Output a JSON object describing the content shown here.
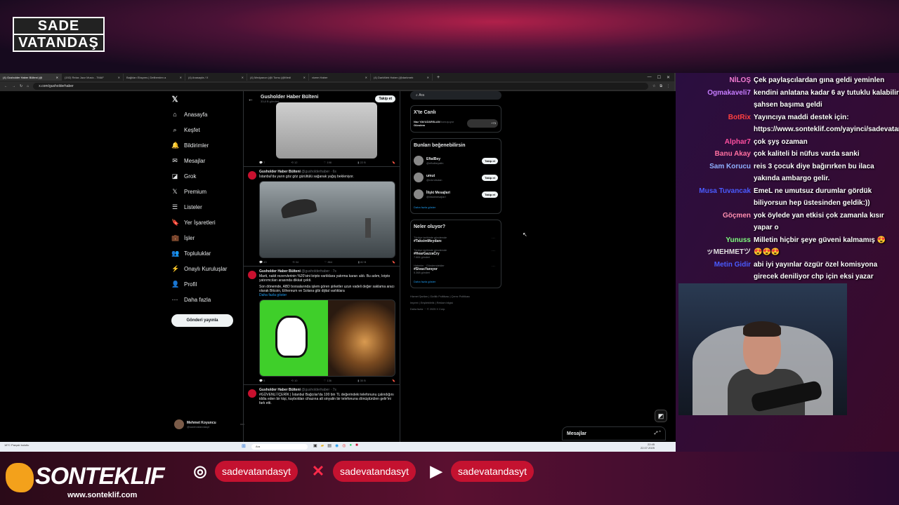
{
  "overlay": {
    "brand_line1": "SADE",
    "brand_line2": "VATANDAŞ"
  },
  "browser": {
    "tabs": [
      "(4) Gusholder Haber Bülteni (@",
      "(192) Relax Jazz Music - 7MAF",
      "Bağlıları Ekspres | Deliberden a",
      "(4) Anasayfa / X",
      "(4) Medyanon (@i Tomu (@Medi",
      "vizem Haber",
      "(4) DarkMeb Haber (@darkmeb"
    ],
    "url": "x.com/gusholderhaber"
  },
  "nav": {
    "items": [
      {
        "label": "Anasayfa",
        "icon": "⌂"
      },
      {
        "label": "Keşfet",
        "icon": "⌕"
      },
      {
        "label": "Bildirimler",
        "icon": "🔔"
      },
      {
        "label": "Mesajlar",
        "icon": "✉"
      },
      {
        "label": "Grok",
        "icon": "◪"
      },
      {
        "label": "Premium",
        "icon": "𝕏"
      },
      {
        "label": "Listeler",
        "icon": "☰"
      },
      {
        "label": "Yer İşaretleri",
        "icon": "🔖"
      },
      {
        "label": "İşler",
        "icon": "💼"
      },
      {
        "label": "Topluluklar",
        "icon": "👥"
      },
      {
        "label": "Onaylı Kuruluşlar",
        "icon": "⚡"
      },
      {
        "label": "Profil",
        "icon": "👤"
      },
      {
        "label": "Daha fazla",
        "icon": "⋯"
      }
    ],
    "post_button": "Gönderi yayınla",
    "profile_name": "Mehmet Koyuncu",
    "profile_handle": "@sadevatandasyt"
  },
  "feed": {
    "header_name": "Gusholder Haber Bülteni",
    "header_sub": "33,8 B gönderi",
    "follow_label": "Takip et",
    "posts": [
      {
        "author": "Gusholder Haber Bülteni",
        "handle": "@gusholderhaber · 6s",
        "text": "İstanbul'da yarın göz göz gürültülü sağanak yağış bekleniyor.",
        "more": "",
        "actions": [
          "43",
          "34",
          "864",
          "82 B"
        ]
      },
      {
        "author": "Gusholder Haber Bülteni",
        "handle": "@gusholderhaber · 7s",
        "text": "Marti, nakit rezervlerinin %20'sini kripto varlıklara yatırma kararı aldı. Bu adım, kripto yatırımcıları arasında dikkat çekti.",
        "text2": "Son dönemde, ABD borsalarında işlem gören şirketler uzun vadeli değer saklama aracı olarak Bitcoin, Ethereum ve Solana gibi dijital varlıklara",
        "more": "Daha fazla göster",
        "actions": [
          "5",
          "10",
          "136",
          "30 B"
        ]
      },
      {
        "author": "Gusholder Haber Bülteni",
        "handle": "@gusholderhaber · 7s",
        "text": "#GÜVENLİ İÇERİK | İstanbul Bağcılar'da 100 bin TL değerindeki telefonunu çalındığını iddia eden bir kişi, kayboldan cihazına alt sinyalin bir telefonuna dönüştürülen gelir'ini fark etti.",
        "more": "",
        "actions": []
      }
    ],
    "top_actions": [
      "7",
      "12",
      "198",
      "22 B"
    ]
  },
  "right": {
    "search_value": "Ara",
    "live_title": "X'te Canlı",
    "live_host": "Naz YAVUZARSLAN",
    "live_host_suffix": "konuşuyor",
    "live_topic": "Gündem",
    "live_count": "+73",
    "suggest_title": "Bunları beğenebilirsin",
    "suggestions": [
      {
        "name": "EftalBey",
        "handle": "@eftalbeyaltn"
      },
      {
        "name": "umut",
        "handle": "@rckndsdan"
      },
      {
        "name": "İlişki Mesajlari",
        "handle": "@iliskimesajlari"
      }
    ],
    "follow_label": "Takip et",
    "show_more": "Daha fazla göster",
    "trends_title": "Neler oluyor?",
    "trends": [
      {
        "ctx": "Türkiye tarihinde gündemde",
        "tag": "#TaksimMeydanı",
        "count": ""
      },
      {
        "ctx": "Türkiye tarihinde gündemde",
        "tag": "#HearGazzaCry",
        "count": "7.684 gönderi"
      },
      {
        "ctx": "Haberler · Gündemdekiler",
        "tag": "#SivasYanıyor",
        "count": "5.368 gönderi"
      }
    ],
    "footer": [
      "Hizmet Şartları  |  Gizlilik Politikası  |  Çerez Politikası",
      "Imprint  |  Erişilebilirlik  |  Reklam bilgisi",
      "Daha fazla ···  © 2025 X Corp."
    ],
    "messages_label": "Mesajlar"
  },
  "taskbar": {
    "weather": "18°C  Parçalı bulutlu",
    "search": "Ara",
    "time": "22:45",
    "date": "22.07.2025"
  },
  "chat": [
    {
      "user": "NİLOŞ",
      "color": "#f27bd1",
      "text": "Çek paylaşcılardan gına geldi yeminlen"
    },
    {
      "user": "Ogmakaveli7",
      "color": "#c77dff",
      "text": "kendini anlatana kadar 6 ay tutuklu kalabilir şahsen başıma geldi"
    },
    {
      "user": "BotRix",
      "color": "#ff4040",
      "text": "Yayıncıya maddi destek için: https://www.sonteklif.com/yayinci/sadevatandas"
    },
    {
      "user": "Alphar7",
      "color": "#ff4fa0",
      "text": "çok şyş ozaman"
    },
    {
      "user": "Banu Akay",
      "color": "#ff6fa0",
      "text": "çok kaliteli bi nüfus varda sanki"
    },
    {
      "user": "Sam Korucu",
      "color": "#8fb0ff",
      "text": "reis 3 çocuk diye bağırırken bu ilaca yakında ambargo gelir."
    },
    {
      "user": "Musa Tuvancak",
      "color": "#4a5bff",
      "text": "EmeL ne umutsuz durumlar gördük biliyorsun hep üstesinden geldik:))"
    },
    {
      "user": "Göçmen",
      "color": "#ff8fb0",
      "text": "yok öylede yan etkisi çok zamanla kısır yapar o"
    },
    {
      "user": "Yunuss",
      "color": "#7fff7f",
      "text": "Milletin hiçbir şeye güveni kalmamış 😍"
    },
    {
      "user": "ッMEHMETツ",
      "color": "#e0e0e0",
      "text": "😍😍😍"
    },
    {
      "user": "Metin Gidir",
      "color": "#4a5bff",
      "text": "abi iyi yayınlar özgür özel komisyona girecek deniliyor chp için eksi yazar"
    }
  ],
  "banner": {
    "brand": "SONTEKLIF",
    "site": "www.sonteklif.com",
    "instagram": "sadevatandasyt",
    "x": "sadevatandasyt",
    "youtube": "sadevatandasyt"
  }
}
